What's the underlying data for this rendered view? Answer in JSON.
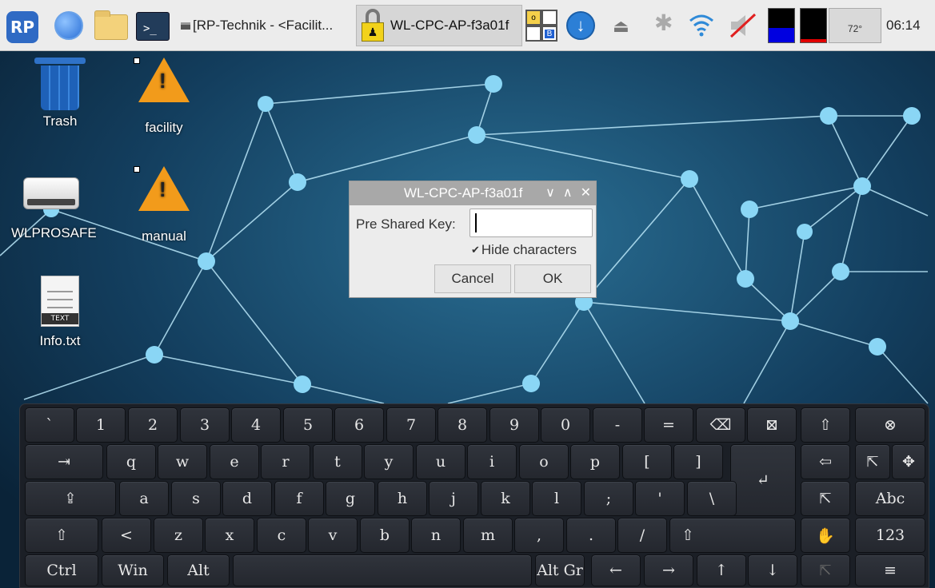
{
  "taskbar": {
    "logo_text": "RP",
    "terminal_text": ">_",
    "task_facility": "[RP-Technik - <Facilit...",
    "task_wlan": "WL-CPC-AP-f3a01f",
    "kbd_tray": {
      "top": "o",
      "bottom": "B"
    },
    "temperature": "72°",
    "clock": "06:14",
    "cpu1_usage_fraction": 0.42,
    "cpu2_usage_fraction": 0.1
  },
  "desktop": {
    "icons": [
      {
        "label": "Trash"
      },
      {
        "label": "facility"
      },
      {
        "label": "WLPROSAFE"
      },
      {
        "label": "manual"
      },
      {
        "label": "Info.txt"
      }
    ]
  },
  "dialog": {
    "title": "WL-CPC-AP-f3a01f",
    "minimize_glyph": "∨",
    "maximize_glyph": "∧",
    "close_glyph": "✕",
    "psk_label": "Pre Shared Key:",
    "psk_value": "",
    "hide_checkbox_glyph": "✔",
    "hide_label": "Hide characters",
    "cancel_label": "Cancel",
    "ok_label": "OK"
  },
  "keyboard": {
    "row1": [
      "`",
      "1",
      "2",
      "3",
      "4",
      "5",
      "6",
      "7",
      "8",
      "9",
      "0",
      "-",
      "=",
      "⌫",
      "⊠",
      "⇧",
      "⊗"
    ],
    "row2": [
      "⇥",
      "q",
      "w",
      "e",
      "r",
      "t",
      "y",
      "u",
      "i",
      "o",
      "p",
      "[",
      "]",
      "↵",
      "⇦",
      "⇱",
      "✥"
    ],
    "row3": [
      "⇪",
      "a",
      "s",
      "d",
      "f",
      "g",
      "h",
      "j",
      "k",
      "l",
      ";",
      "'",
      "\\",
      "⇱"
    ],
    "row4": [
      "⇧",
      "<",
      "z",
      "x",
      "c",
      "v",
      "b",
      "n",
      "m",
      ",",
      ".",
      "/",
      "⇧",
      "✋",
      "123"
    ],
    "row5": [
      "Ctrl",
      "Win",
      "Alt",
      "",
      "Alt Gr",
      "←",
      "→",
      "↑",
      "↓",
      "⇱",
      "≡"
    ],
    "abc_label": "Abc"
  },
  "colors": {
    "taskbar_bg": "#ececec",
    "dialog_title_bg": "#a8a8a8",
    "keyboard_bg": "#1b1f26",
    "node_color": "#8ad6f5"
  }
}
